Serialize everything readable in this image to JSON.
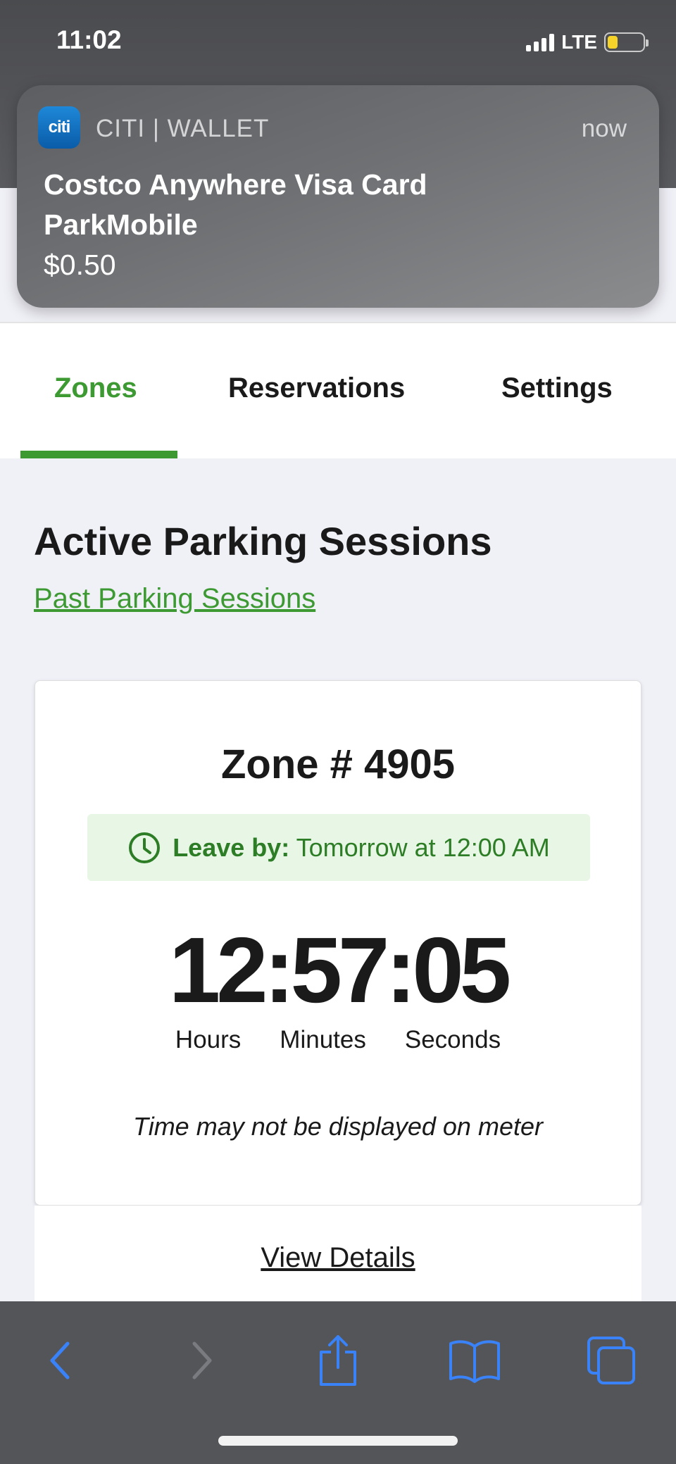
{
  "status_bar": {
    "time": "11:02",
    "network": "LTE"
  },
  "notification": {
    "app_icon_text": "citi",
    "app_name": "CITI | WALLET",
    "time": "now",
    "line1": "Costco Anywhere Visa Card",
    "line2": "ParkMobile",
    "line3": "$0.50"
  },
  "tabs": [
    {
      "label": "Zones",
      "active": true
    },
    {
      "label": "Reservations",
      "active": false
    },
    {
      "label": "Settings",
      "active": false
    }
  ],
  "main": {
    "title": "Active Parking Sessions",
    "past_link": "Past Parking Sessions"
  },
  "session": {
    "zone": "Zone # 4905",
    "leave_label": "Leave by:",
    "leave_value": "Tomorrow at 12:00 AM",
    "timer": "12:57:05",
    "hours_label": "Hours",
    "minutes_label": "Minutes",
    "seconds_label": "Seconds",
    "note": "Time may not be displayed on meter",
    "details_link": "View Details"
  },
  "toolbar": {
    "icons": [
      "back-icon",
      "forward-icon",
      "share-icon",
      "bookmarks-icon",
      "tabs-icon"
    ]
  },
  "colors": {
    "accent_green": "#3d9a33",
    "leave_bg": "#e8f6e5",
    "toolbar_bg": "#545559",
    "ios_blue": "#3a82f7"
  }
}
